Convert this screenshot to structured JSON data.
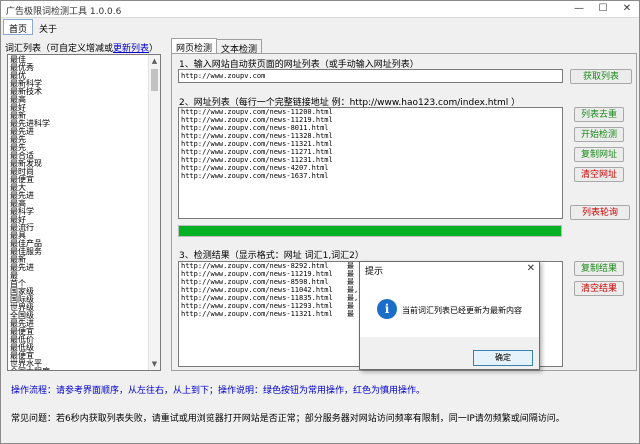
{
  "window": {
    "title": "广告极限词检测工具 1.0.0.6"
  },
  "menu": {
    "items": [
      "首页",
      "关于"
    ]
  },
  "word_list": {
    "label": "词汇列表（可自定义增减或",
    "update_link": "更新列表",
    "label_end": "）",
    "items": [
      "最佳",
      "最优秀",
      "最优",
      "最新科学",
      "最新技术",
      "最高",
      "最好",
      "最新",
      "最先进科学",
      "最先进",
      "最先",
      "最先",
      "最合适",
      "最新发现",
      "最时尚",
      "最便宜",
      "最大",
      "最先进",
      "最高",
      "最科学",
      "最好",
      "最流行",
      "最具",
      "最佳产品",
      "最佳服务",
      "最新",
      "最先进",
      "最",
      "首个",
      "国家级",
      "国际级",
      "世界级",
      "全国级",
      "最先进",
      "最便宜",
      "最低价",
      "最低级",
      "最便宜",
      "世界水平",
      "全国大程度",
      "最先进",
      "最便宜",
      "最先进",
      "最"
    ]
  },
  "tabs": {
    "web": "网页检测",
    "text": "文本检测"
  },
  "section1": {
    "label": "1、输入网站自动获页面的网址列表（或手动输入网址列表）",
    "url": "http://www.zoupv.com",
    "button": "获取列表"
  },
  "section2": {
    "label": "2、网址列表（每行一个完整链接地址 例：http://www.hao123.com/index.html ）",
    "lines": [
      "http://www.zoupv.com/news-11200.html",
      "http://www.zoupv.com/news-11219.html",
      "http://www.zoupv.com/news-8011.html",
      "http://www.zoupv.com/news-11328.html",
      "http://www.zoupv.com/news-11321.html",
      "http://www.zoupv.com/news-11271.html",
      "http://www.zoupv.com/news-11231.html",
      "http://www.zoupv.com/news-4207.html",
      "http://www.zoupv.com/news-1637.html"
    ],
    "buttons": {
      "dedupe": "列表去重",
      "start": "开始检测",
      "copy": "复制网址",
      "clear": "清空网址",
      "rotate": "列表轮询"
    }
  },
  "progress": {
    "value": 1.0,
    "color": "#06b025"
  },
  "section3": {
    "label": "3、检测结果（显示格式：网址 词汇1,词汇2）",
    "lines": [
      "http://www.zoupv.com/news-8292.html",
      "http://www.zoupv.com/news-11219.html",
      "http://www.zoupv.com/news-8598.html",
      "http://www.zoupv.com/news-11042.html",
      "http://www.zoupv.com/news-11835.html",
      "http://www.zoupv.com/news-11293.html",
      "http://www.zoupv.com/news-11321.html"
    ],
    "tags": [
      "最",
      "最",
      "最",
      "最,",
      "最,",
      "最",
      "最"
    ],
    "buttons": {
      "copy": "复制结果",
      "clear": "清空结果"
    }
  },
  "dialog": {
    "title": "提示",
    "message": "当前词汇列表已经更新为最新内容",
    "ok": "确定"
  },
  "footer": {
    "line1": "操作流程：请参考界面顺序，从左往右，从上到下；操作说明：绿色按钮为常用操作，红色为慎用操作。",
    "line2": "常见问题：若6秒内获取列表失败，请重试或用浏览器打开网站是否正常；部分服务器对网站访问频率有限制，同一IP请勿频繁或间隔访问。"
  }
}
